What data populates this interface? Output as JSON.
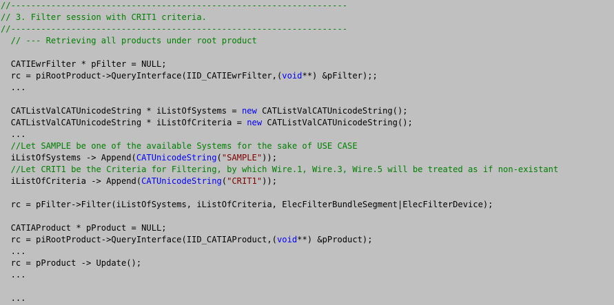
{
  "colors": {
    "background": "#c0c0c0",
    "text": "#000000",
    "comment": "#008000",
    "keyword": "#0000ff",
    "string": "#800000"
  },
  "code": {
    "lines": [
      [
        {
          "t": "//-------------------------------------------------------------------",
          "c": "comment"
        }
      ],
      [
        {
          "t": "// 3. Filter session with CRIT1 criteria.",
          "c": "comment"
        }
      ],
      [
        {
          "t": "//-------------------------------------------------------------------",
          "c": "comment"
        }
      ],
      [
        {
          "t": "  // --- Retrieving all products under root product",
          "c": "comment"
        }
      ],
      [],
      [
        {
          "t": "  CATIEwrFilter * pFilter = NULL;",
          "c": "default"
        }
      ],
      [
        {
          "t": "  rc = piRootProduct->QueryInterface(IID_CATIEwrFilter,(",
          "c": "default"
        },
        {
          "t": "void",
          "c": "keyword"
        },
        {
          "t": "**) &pFilter);;",
          "c": "default"
        }
      ],
      [
        {
          "t": "  ...",
          "c": "default"
        }
      ],
      [],
      [
        {
          "t": "  CATListValCATUnicodeString * iListOfSystems = ",
          "c": "default"
        },
        {
          "t": "new",
          "c": "keyword"
        },
        {
          "t": " CATListValCATUnicodeString();",
          "c": "default"
        }
      ],
      [
        {
          "t": "  CATListValCATUnicodeString * iListOfCriteria = ",
          "c": "default"
        },
        {
          "t": "new",
          "c": "keyword"
        },
        {
          "t": " CATListValCATUnicodeString();",
          "c": "default"
        }
      ],
      [
        {
          "t": "  ...",
          "c": "default"
        }
      ],
      [
        {
          "t": "  //Let SAMPLE be one of the available Systems for the sake of USE CASE",
          "c": "comment"
        }
      ],
      [
        {
          "t": "  iListOfSystems -> Append(",
          "c": "default"
        },
        {
          "t": "CATUnicodeString",
          "c": "keyword"
        },
        {
          "t": "(",
          "c": "default"
        },
        {
          "t": "\"SAMPLE\"",
          "c": "string"
        },
        {
          "t": "));",
          "c": "default"
        }
      ],
      [
        {
          "t": "  //Let CRIT1 be the Criteria for Filtering, by which Wire.1, Wire.3, Wire.5 will be treated as if non-existant",
          "c": "comment"
        }
      ],
      [
        {
          "t": "  iListOfCriteria -> Append(",
          "c": "default"
        },
        {
          "t": "CATUnicodeString",
          "c": "keyword"
        },
        {
          "t": "(",
          "c": "default"
        },
        {
          "t": "\"CRIT1\"",
          "c": "string"
        },
        {
          "t": "));",
          "c": "default"
        }
      ],
      [],
      [
        {
          "t": "  rc = pFilter->Filter(iListOfSystems, iListOfCriteria, ElecFilterBundleSegment|ElecFilterDevice);",
          "c": "default"
        }
      ],
      [],
      [
        {
          "t": "  CATIAProduct * pProduct = NULL;",
          "c": "default"
        }
      ],
      [
        {
          "t": "  rc = piRootProduct->QueryInterface(IID_CATIAProduct,(",
          "c": "default"
        },
        {
          "t": "void",
          "c": "keyword"
        },
        {
          "t": "**) &pProduct);",
          "c": "default"
        }
      ],
      [
        {
          "t": "  ...",
          "c": "default"
        }
      ],
      [
        {
          "t": "  rc = pProduct -> Update();",
          "c": "default"
        }
      ],
      [
        {
          "t": "  ...",
          "c": "default"
        }
      ],
      [],
      [
        {
          "t": "  ...",
          "c": "default"
        }
      ]
    ]
  }
}
